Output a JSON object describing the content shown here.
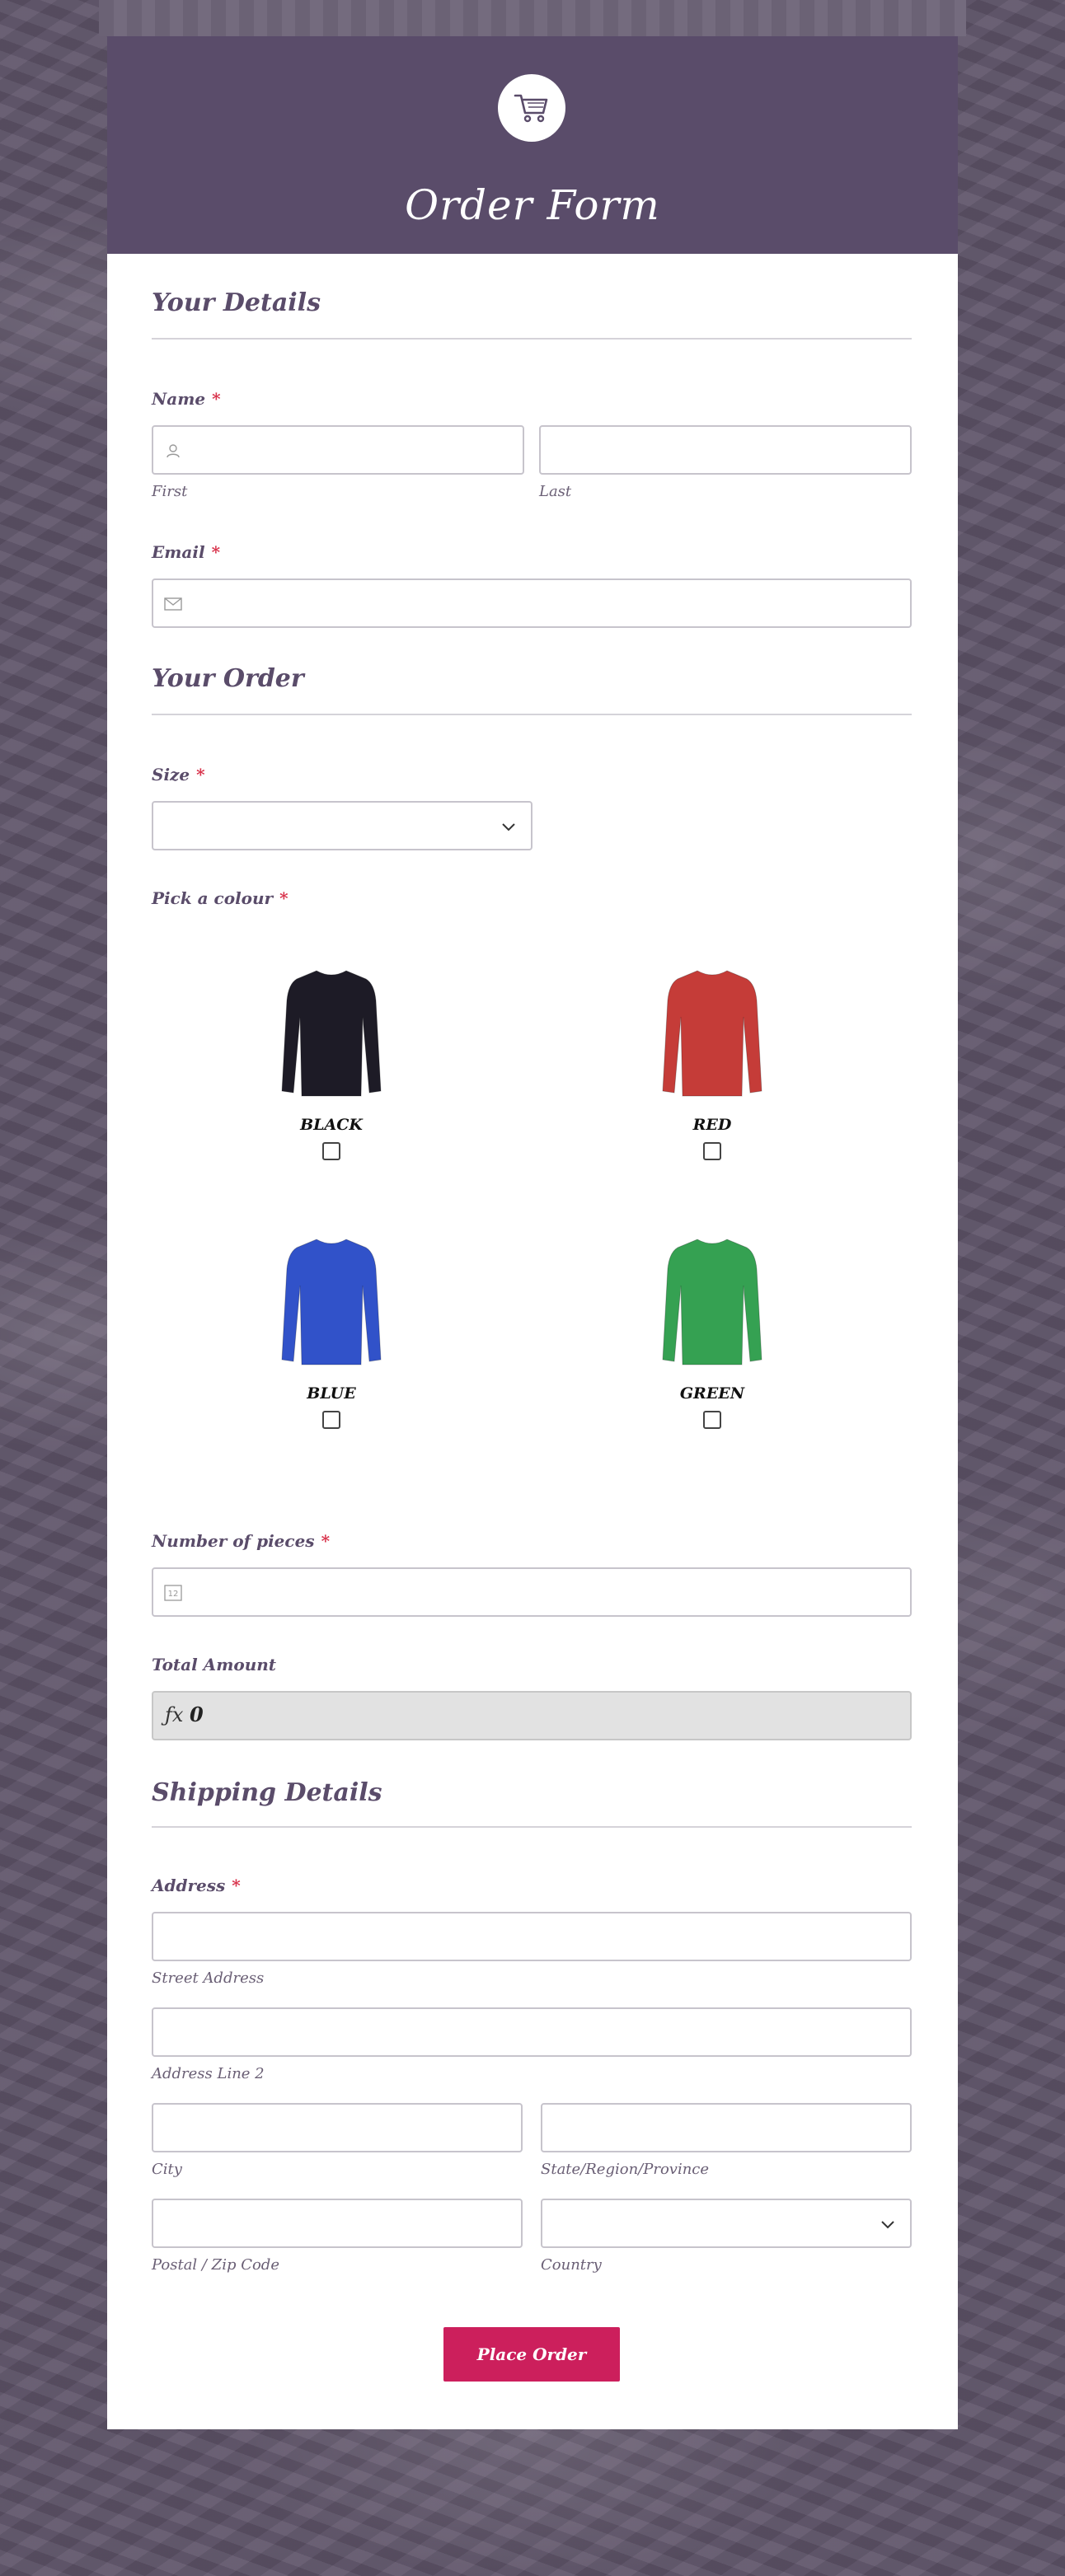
{
  "form": {
    "title": "Order Form",
    "logo_icon": "shopping-cart-icon"
  },
  "sections": {
    "details": "Your Details",
    "order": "Your Order",
    "shipping": "Shipping Details"
  },
  "name": {
    "label": "Name",
    "required": "*",
    "first_label": "First",
    "last_label": "Last",
    "first_icon": "user-icon",
    "first_value": "",
    "last_value": ""
  },
  "email": {
    "label": "Email",
    "required": "*",
    "icon": "envelope-icon",
    "value": ""
  },
  "size": {
    "label": "Size",
    "required": "*",
    "selected": ""
  },
  "colour": {
    "label": "Pick a colour",
    "required": "*",
    "options": [
      {
        "name": "BLACK",
        "color": "#1d1b26",
        "checked": false
      },
      {
        "name": "RED",
        "color": "#c53c38",
        "checked": false
      },
      {
        "name": "BLUE",
        "color": "#3152c9",
        "checked": false
      },
      {
        "name": "GREEN",
        "color": "#35a152",
        "checked": false
      }
    ]
  },
  "pieces": {
    "label": "Number of pieces",
    "required": "*",
    "icon": "number-icon",
    "value": ""
  },
  "total": {
    "label": "Total Amount",
    "icon": "function-icon",
    "value": "0"
  },
  "address": {
    "label": "Address",
    "required": "*",
    "street_label": "Street Address",
    "line2_label": "Address Line 2",
    "city_label": "City",
    "state_label": "State/Region/Province",
    "zip_label": "Postal / Zip Code",
    "country_label": "Country",
    "country_selected": ""
  },
  "submit": {
    "label": "Place Order"
  },
  "colors": {
    "header": "#5a4c6a",
    "accent": "#cc1f5c",
    "required": "#d8314a"
  }
}
